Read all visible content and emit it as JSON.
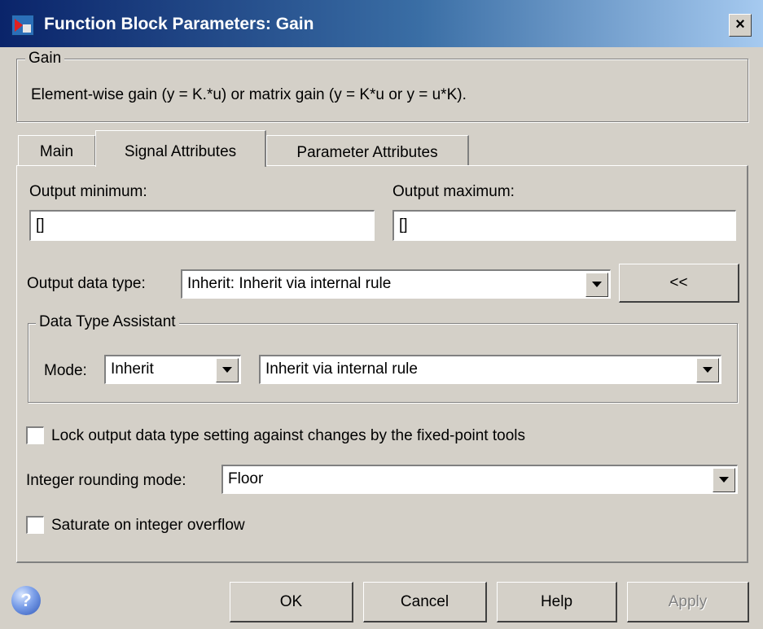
{
  "window": {
    "title": "Function Block Parameters: Gain",
    "close_glyph": "×"
  },
  "gain_group": {
    "legend": "Gain",
    "description": "Element-wise gain (y = K.*u) or matrix gain (y = K*u or y = u*K)."
  },
  "tabs": [
    {
      "label": "Main",
      "active": false
    },
    {
      "label": "Signal Attributes",
      "active": true
    },
    {
      "label": "Parameter Attributes",
      "active": false
    }
  ],
  "signal_attributes": {
    "output_minimum_label": "Output minimum:",
    "output_minimum_value": "[]",
    "output_maximum_label": "Output maximum:",
    "output_maximum_value": "[]",
    "output_data_type_label": "Output data type:",
    "output_data_type_value": "Inherit: Inherit via internal rule",
    "assistant_toggle_label": "<<",
    "assistant": {
      "legend": "Data Type Assistant",
      "mode_label": "Mode:",
      "mode_value": "Inherit",
      "rule_value": "Inherit via internal rule"
    },
    "lock_label": "Lock output data type setting against changes by the fixed-point tools",
    "lock_checked": false,
    "rounding_label": "Integer rounding mode:",
    "rounding_value": "Floor",
    "saturate_label": "Saturate on integer overflow",
    "saturate_checked": false
  },
  "buttons": {
    "ok": "OK",
    "cancel": "Cancel",
    "help": "Help",
    "apply": "Apply"
  },
  "help_icon_glyph": "?",
  "colors": {
    "title_start": "#0a246a",
    "title_end": "#a6caf0",
    "face": "#d4d0c8"
  }
}
